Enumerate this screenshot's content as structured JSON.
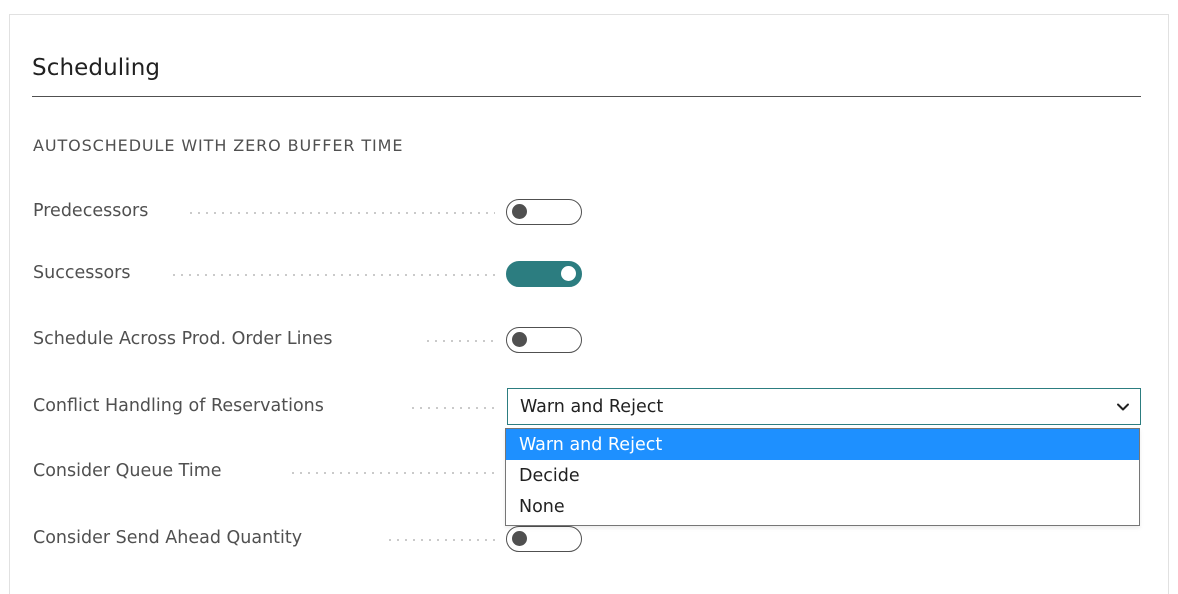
{
  "section": {
    "title": "Scheduling",
    "group_caption": "AUTOSCHEDULE WITH ZERO BUFFER TIME"
  },
  "fields": {
    "predecessors": {
      "label": "Predecessors",
      "state": "off"
    },
    "successors": {
      "label": "Successors",
      "state": "on"
    },
    "schedule_across": {
      "label": "Schedule Across Prod. Order Lines",
      "state": "off"
    },
    "conflict_handling": {
      "label": "Conflict Handling of Reservations",
      "value": "Warn and Reject",
      "options": [
        "Warn and Reject",
        "Decide",
        "None"
      ],
      "selected_option": "Warn and Reject"
    },
    "consider_queue_time": {
      "label": "Consider Queue Time",
      "state": "off"
    },
    "consider_send_ahead": {
      "label": "Consider Send Ahead Quantity",
      "state": "off"
    }
  },
  "colors": {
    "toggle_on": "#2c7d80",
    "selected_option_bg": "#1e90ff",
    "select_border": "#2c7d80"
  },
  "icons": {
    "dropdown": "chevron-down-icon"
  }
}
